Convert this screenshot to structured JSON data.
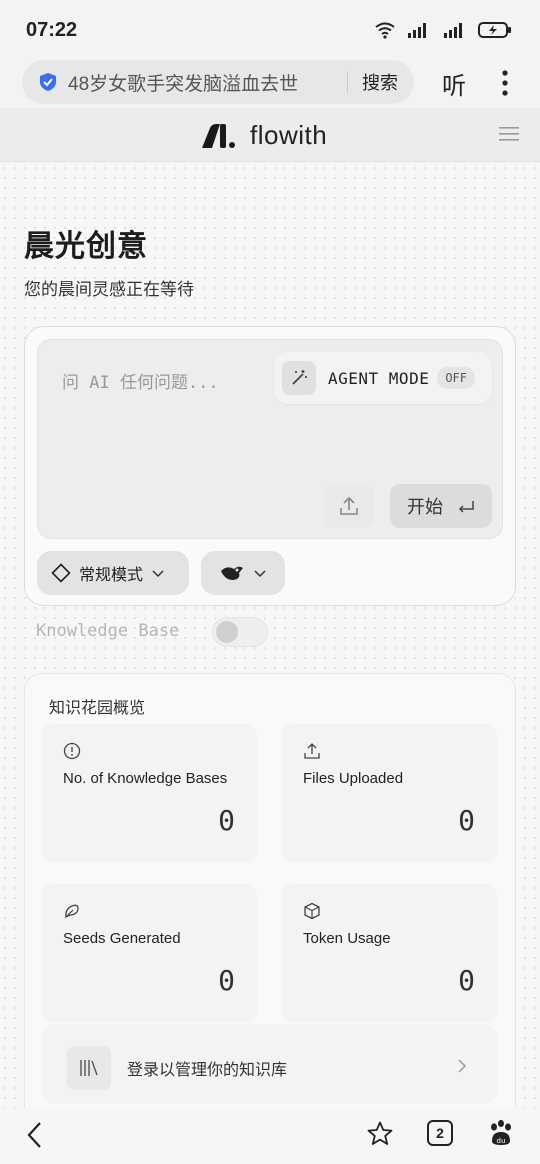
{
  "status_bar": {
    "time": "07:22"
  },
  "browser": {
    "address_text": "48岁女歌手突发脑溢血去世",
    "search_label": "搜索",
    "listen_label": "听"
  },
  "header": {
    "logo_text": "flowith"
  },
  "page": {
    "title": "晨光创意",
    "subtitle": "您的晨间灵感正在等待"
  },
  "chat": {
    "placeholder": "问 AI 任何问题...",
    "agent_mode_label": "AGENT MODE",
    "agent_mode_state": "OFF",
    "start_label": "开始",
    "mode_label": "常规模式"
  },
  "knowledge_base": {
    "label": "Knowledge Base",
    "enabled": false
  },
  "overview": {
    "title": "知识花园概览",
    "stats": [
      {
        "label": "No. of Knowledge Bases",
        "value": "0",
        "icon": "info-circle-icon"
      },
      {
        "label": "Files Uploaded",
        "value": "0",
        "icon": "upload-icon"
      },
      {
        "label": "Seeds Generated",
        "value": "0",
        "icon": "seed-icon"
      },
      {
        "label": "Token Usage",
        "value": "0",
        "icon": "cube-icon"
      }
    ],
    "login_text": "登录以管理你的知识库"
  },
  "bottom_nav": {
    "tab_count": "2"
  }
}
